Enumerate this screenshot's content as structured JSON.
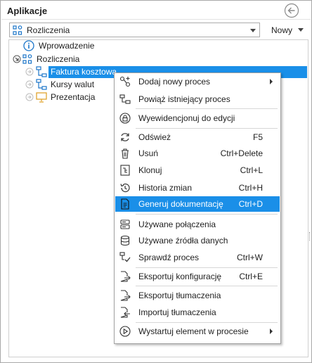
{
  "header": {
    "title": "Aplikacje"
  },
  "combo": {
    "value": "Rozliczenia"
  },
  "nowy_label": "Nowy",
  "tree": {
    "items": [
      {
        "label": "Wprowadzenie"
      },
      {
        "label": "Rozliczenia"
      },
      {
        "label": "Faktura kosztowa"
      },
      {
        "label": "Kursy walut"
      },
      {
        "label": "Prezentacja"
      }
    ]
  },
  "context_menu": {
    "items": [
      {
        "label": "Dodaj nowy proces",
        "shortcut": "",
        "icon": "add-process-icon",
        "submenu": true
      },
      {
        "label": "Powiąż istniejący proces",
        "shortcut": "",
        "icon": "link-process-icon"
      },
      {
        "label": "Wyewidencjonuj do edycji",
        "shortcut": "",
        "icon": "checkout-lock-icon"
      },
      {
        "label": "Odśwież",
        "shortcut": "F5",
        "icon": "refresh-icon"
      },
      {
        "label": "Usuń",
        "shortcut": "Ctrl+Delete",
        "icon": "trash-icon"
      },
      {
        "label": "Klonuj",
        "shortcut": "Ctrl+L",
        "icon": "clone-icon"
      },
      {
        "label": "Historia zmian",
        "shortcut": "Ctrl+H",
        "icon": "history-icon"
      },
      {
        "label": "Generuj dokumentację",
        "shortcut": "Ctrl+D",
        "icon": "document-icon",
        "highlighted": true
      },
      {
        "label": "Używane połączenia",
        "shortcut": "",
        "icon": "connections-icon"
      },
      {
        "label": "Używane źródła danych",
        "shortcut": "",
        "icon": "database-icon"
      },
      {
        "label": "Sprawdź proces",
        "shortcut": "Ctrl+W",
        "icon": "check-process-icon"
      },
      {
        "label": "Eksportuj konfigurację",
        "shortcut": "Ctrl+E",
        "icon": "export-config-icon"
      },
      {
        "label": "Eksportuj tłumaczenia",
        "shortcut": "",
        "icon": "export-translations-icon"
      },
      {
        "label": "Importuj tłumaczenia",
        "shortcut": "",
        "icon": "import-translations-icon"
      },
      {
        "label": "Wystartuj element w procesie",
        "shortcut": "",
        "icon": "play-icon",
        "submenu": true
      }
    ]
  },
  "colors": {
    "accent": "#1a8fe8",
    "icon_blue": "#1b75c9",
    "folder_yellow": "#e8b84a"
  }
}
